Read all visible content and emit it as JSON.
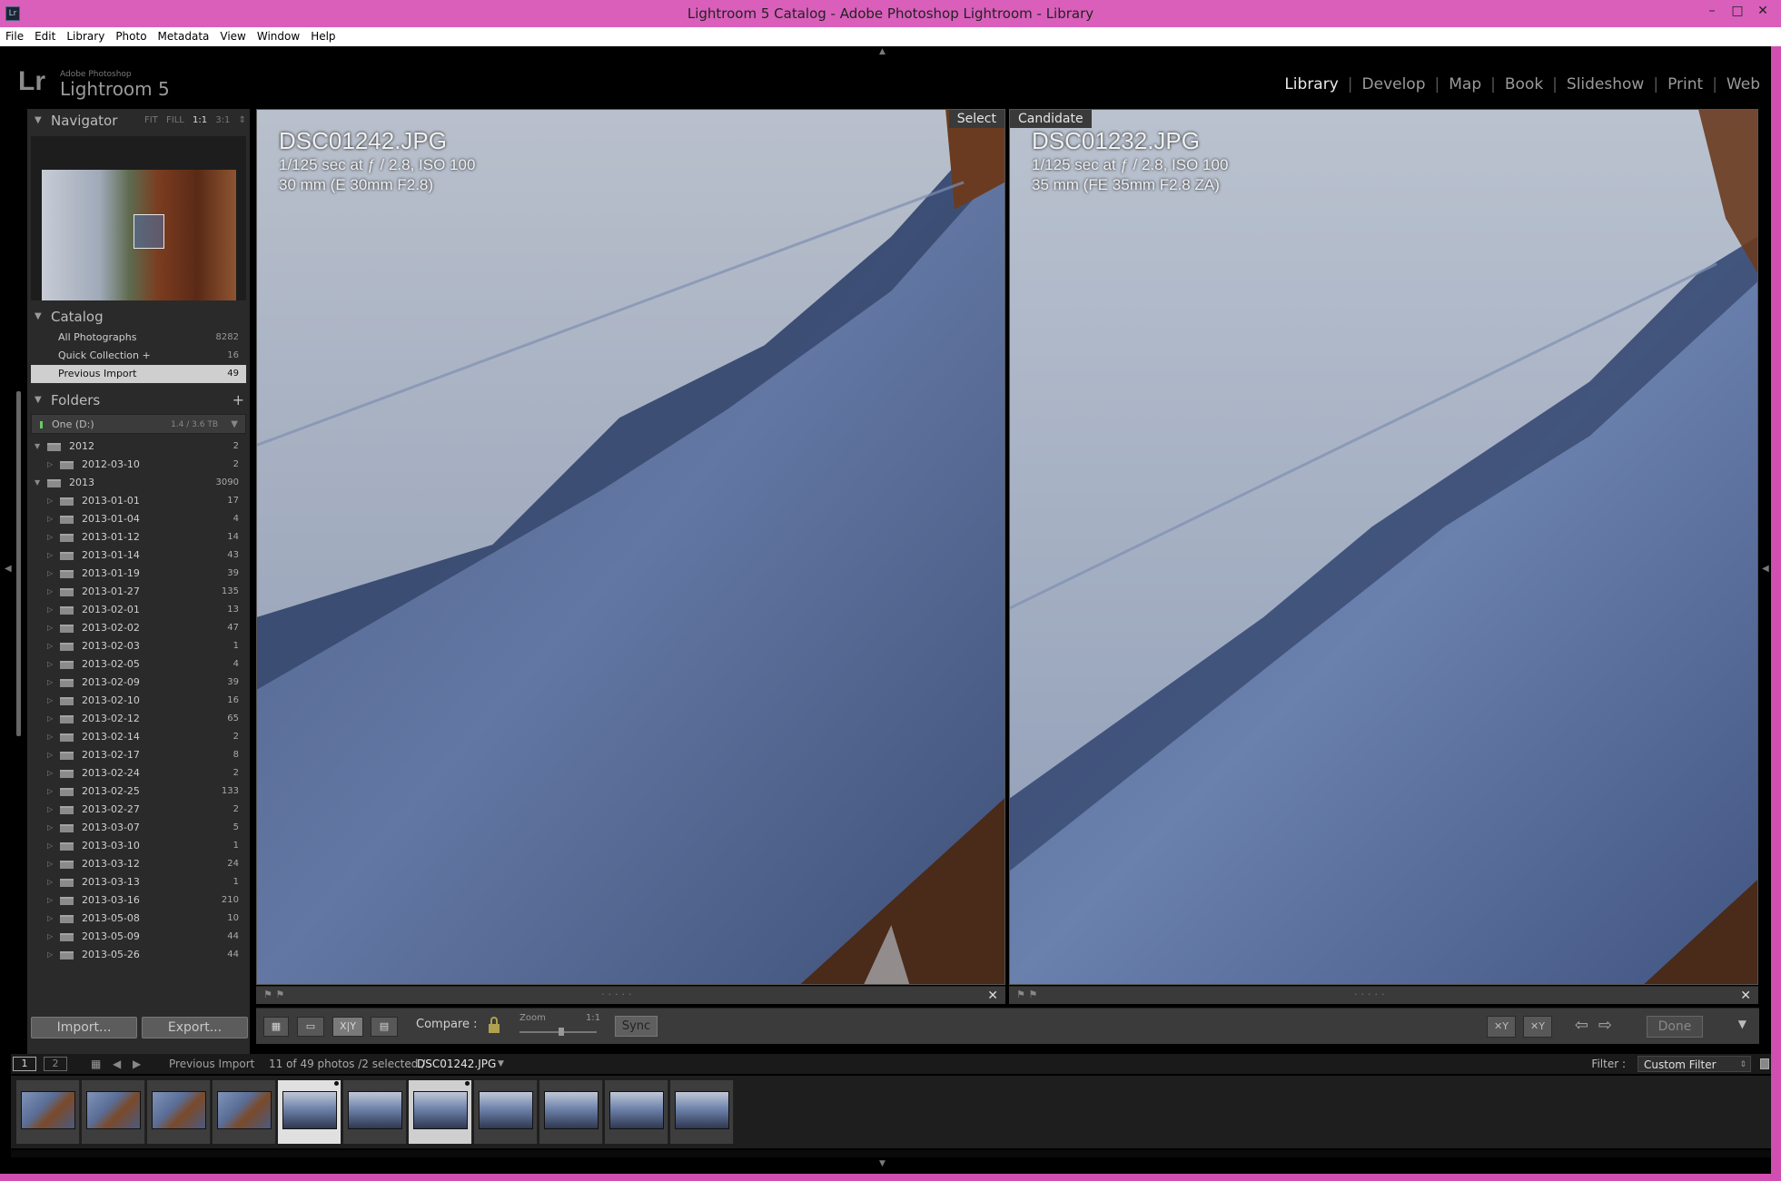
{
  "window": {
    "title": "Lightroom 5 Catalog - Adobe Photoshop Lightroom - Library",
    "app_icon": "Lr",
    "minimize": "–",
    "maximize": "□",
    "close": "✕"
  },
  "menu": [
    "File",
    "Edit",
    "Library",
    "Photo",
    "Metadata",
    "View",
    "Window",
    "Help"
  ],
  "identity_plate": {
    "logo": "Lr",
    "small": "Adobe Photoshop",
    "product": "Lightroom 5"
  },
  "modules": {
    "items": [
      "Library",
      "Develop",
      "Map",
      "Book",
      "Slideshow",
      "Print",
      "Web"
    ],
    "active": "Library"
  },
  "navigator": {
    "title": "Navigator",
    "options": [
      "FIT",
      "FILL",
      "1:1",
      "3:1"
    ],
    "selected_option": "1:1"
  },
  "catalog": {
    "title": "Catalog",
    "items": [
      {
        "label": "All Photographs",
        "count": "8282"
      },
      {
        "label": "Quick Collection +",
        "count": "16"
      },
      {
        "label": "Previous Import",
        "count": "49",
        "selected": true
      }
    ]
  },
  "folders": {
    "title": "Folders",
    "add": "+",
    "volume": {
      "name": "One (D:)",
      "size": "1.4 / 3.6 TB"
    },
    "items": [
      {
        "name": "2012",
        "count": "2",
        "level": 0
      },
      {
        "name": "2012-03-10",
        "count": "2",
        "level": 1
      },
      {
        "name": "2013",
        "count": "3090",
        "level": 0
      },
      {
        "name": "2013-01-01",
        "count": "17",
        "level": 1
      },
      {
        "name": "2013-01-04",
        "count": "4",
        "level": 1
      },
      {
        "name": "2013-01-12",
        "count": "14",
        "level": 1
      },
      {
        "name": "2013-01-14",
        "count": "43",
        "level": 1
      },
      {
        "name": "2013-01-19",
        "count": "39",
        "level": 1
      },
      {
        "name": "2013-01-27",
        "count": "135",
        "level": 1
      },
      {
        "name": "2013-02-01",
        "count": "13",
        "level": 1
      },
      {
        "name": "2013-02-02",
        "count": "47",
        "level": 1
      },
      {
        "name": "2013-02-03",
        "count": "1",
        "level": 1
      },
      {
        "name": "2013-02-05",
        "count": "4",
        "level": 1
      },
      {
        "name": "2013-02-09",
        "count": "39",
        "level": 1
      },
      {
        "name": "2013-02-10",
        "count": "16",
        "level": 1
      },
      {
        "name": "2013-02-12",
        "count": "65",
        "level": 1
      },
      {
        "name": "2013-02-14",
        "count": "2",
        "level": 1
      },
      {
        "name": "2013-02-17",
        "count": "8",
        "level": 1
      },
      {
        "name": "2013-02-24",
        "count": "2",
        "level": 1
      },
      {
        "name": "2013-02-25",
        "count": "133",
        "level": 1
      },
      {
        "name": "2013-02-27",
        "count": "2",
        "level": 1
      },
      {
        "name": "2013-03-07",
        "count": "5",
        "level": 1
      },
      {
        "name": "2013-03-10",
        "count": "1",
        "level": 1
      },
      {
        "name": "2013-03-12",
        "count": "24",
        "level": 1
      },
      {
        "name": "2013-03-13",
        "count": "1",
        "level": 1
      },
      {
        "name": "2013-03-16",
        "count": "210",
        "level": 1
      },
      {
        "name": "2013-05-08",
        "count": "10",
        "level": 1
      },
      {
        "name": "2013-05-09",
        "count": "44",
        "level": 1
      },
      {
        "name": "2013-05-26",
        "count": "44",
        "level": 1
      }
    ]
  },
  "buttons": {
    "import": "Import...",
    "export": "Export..."
  },
  "compare": {
    "select": {
      "tag": "Select",
      "filename": "DSC01242.JPG",
      "exposure": "1/125 sec at ƒ / 2.8, ISO 100",
      "lens": "30 mm (E 30mm F2.8)"
    },
    "candidate": {
      "tag": "Candidate",
      "filename": "DSC01232.JPG",
      "exposure": "1/125 sec at ƒ / 2.8, ISO 100",
      "lens": "35 mm (FE 35mm F2.8 ZA)"
    }
  },
  "toolbar": {
    "compare_label": "Compare :",
    "zoom_label": "Zoom",
    "zoom_value": "1:1",
    "sync": "Sync",
    "done": "Done",
    "xy": "X|Y"
  },
  "filmstrip_header": {
    "screen1": "1",
    "screen2": "2",
    "source": "Previous Import",
    "status": "11 of 49 photos /2 selected /",
    "current_file": "DSC01242.JPG",
    "filter_label": "Filter :",
    "filter_value": "Custom Filter"
  },
  "filmstrip": {
    "count": 11,
    "selected_index": 4,
    "candidate_index": 6
  }
}
